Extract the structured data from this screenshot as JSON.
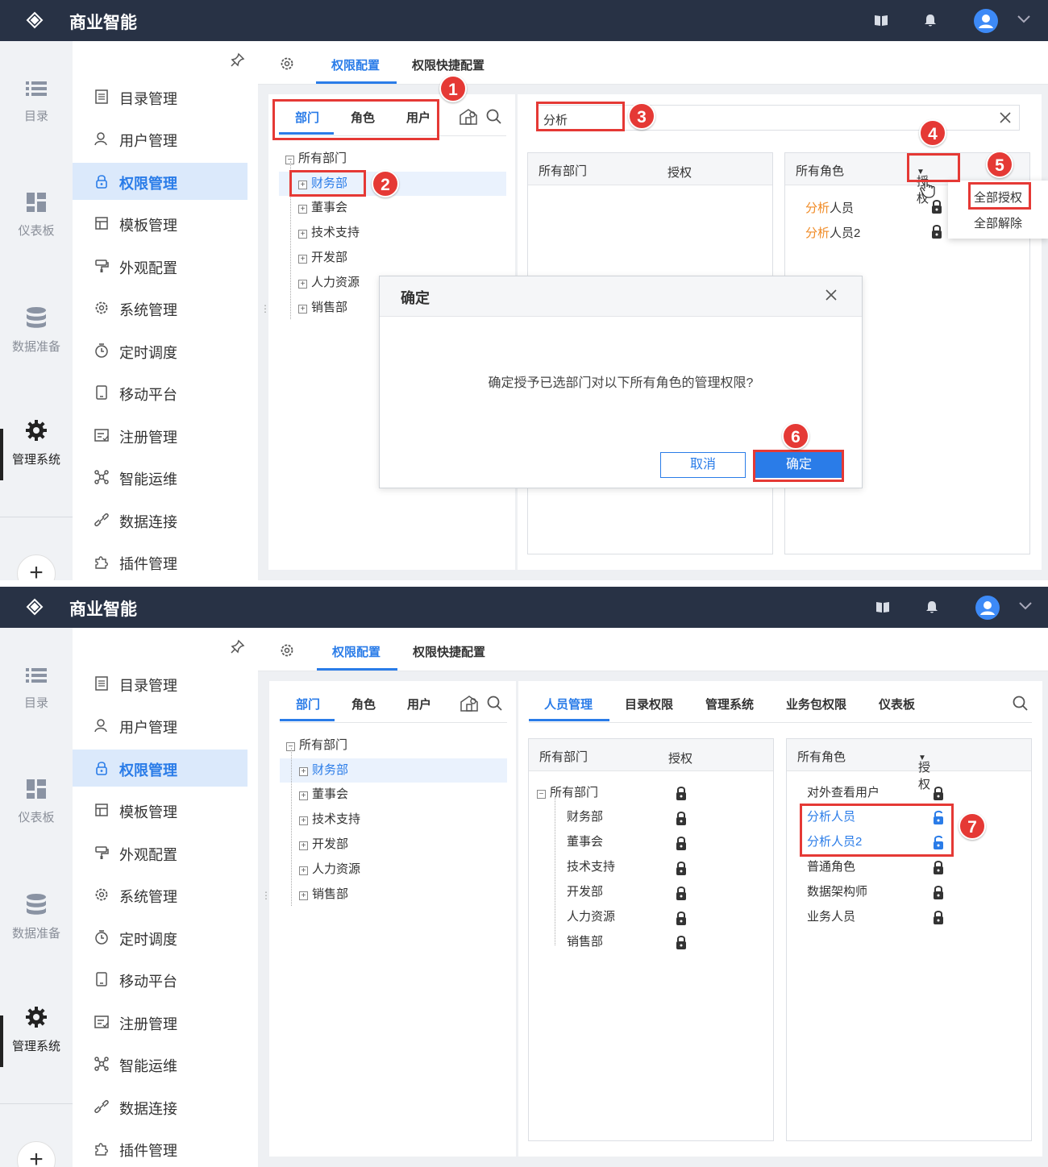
{
  "app": {
    "title": "商业智能"
  },
  "rail": [
    {
      "label": "目录",
      "icon": "list-icon"
    },
    {
      "label": "仪表板",
      "icon": "dashboard-icon"
    },
    {
      "label": "数据准备",
      "icon": "database-icon"
    },
    {
      "label": "管理系统",
      "icon": "gear-icon",
      "active": true
    }
  ],
  "rail_plus": "+",
  "menu": [
    {
      "label": "目录管理",
      "icon": "catalog-icon"
    },
    {
      "label": "用户管理",
      "icon": "user-icon"
    },
    {
      "label": "权限管理",
      "icon": "lock-icon",
      "active": true
    },
    {
      "label": "模板管理",
      "icon": "template-icon"
    },
    {
      "label": "外观配置",
      "icon": "paint-icon"
    },
    {
      "label": "系统管理",
      "icon": "settings-icon"
    },
    {
      "label": "定时调度",
      "icon": "timer-icon"
    },
    {
      "label": "移动平台",
      "icon": "mobile-icon"
    },
    {
      "label": "注册管理",
      "icon": "register-icon"
    },
    {
      "label": "智能运维",
      "icon": "ops-icon"
    },
    {
      "label": "数据连接",
      "icon": "link-icon"
    },
    {
      "label": "插件管理",
      "icon": "plugin-icon"
    }
  ],
  "page_tabs": {
    "active": "权限配置",
    "other": "权限快捷配置"
  },
  "left_tabs": [
    "部门",
    "角色",
    "用户"
  ],
  "tree": {
    "root": "所有部门",
    "children": [
      "财务部",
      "董事会",
      "技术支持",
      "开发部",
      "人力资源",
      "销售部"
    ],
    "selected": "财务部"
  },
  "search_value": "分析",
  "dept_header": {
    "col1": "所有部门",
    "col2": "授权"
  },
  "role_header": {
    "col1": "所有角色",
    "col2": "授权"
  },
  "filtered_roles": [
    {
      "prefix": "分析",
      "suffix": "人员"
    },
    {
      "prefix": "分析",
      "suffix": "人员2"
    }
  ],
  "dropdown": [
    "全部授权",
    "全部解除"
  ],
  "dialog": {
    "title": "确定",
    "message": "确定授予已选部门对以下所有角色的管理权限?",
    "cancel": "取消",
    "ok": "确定"
  },
  "right_tabs": [
    "人员管理",
    "目录权限",
    "管理系统",
    "业务包权限",
    "仪表板"
  ],
  "dept_list": [
    "所有部门",
    "财务部",
    "董事会",
    "技术支持",
    "开发部",
    "人力资源",
    "销售部"
  ],
  "role_list": [
    {
      "name": "对外查看用户",
      "granted": false
    },
    {
      "name": "分析人员",
      "granted": true
    },
    {
      "name": "分析人员2",
      "granted": true
    },
    {
      "name": "普通角色",
      "granted": false
    },
    {
      "name": "数据架构师",
      "granted": false
    },
    {
      "name": "业务人员",
      "granted": false
    }
  ],
  "badges": [
    "1",
    "2",
    "3",
    "4",
    "5",
    "6",
    "7"
  ],
  "colors": {
    "accent": "#2a7ce8",
    "topbar": "#283245",
    "highlight": "#e53935",
    "match": "#f08a24"
  }
}
